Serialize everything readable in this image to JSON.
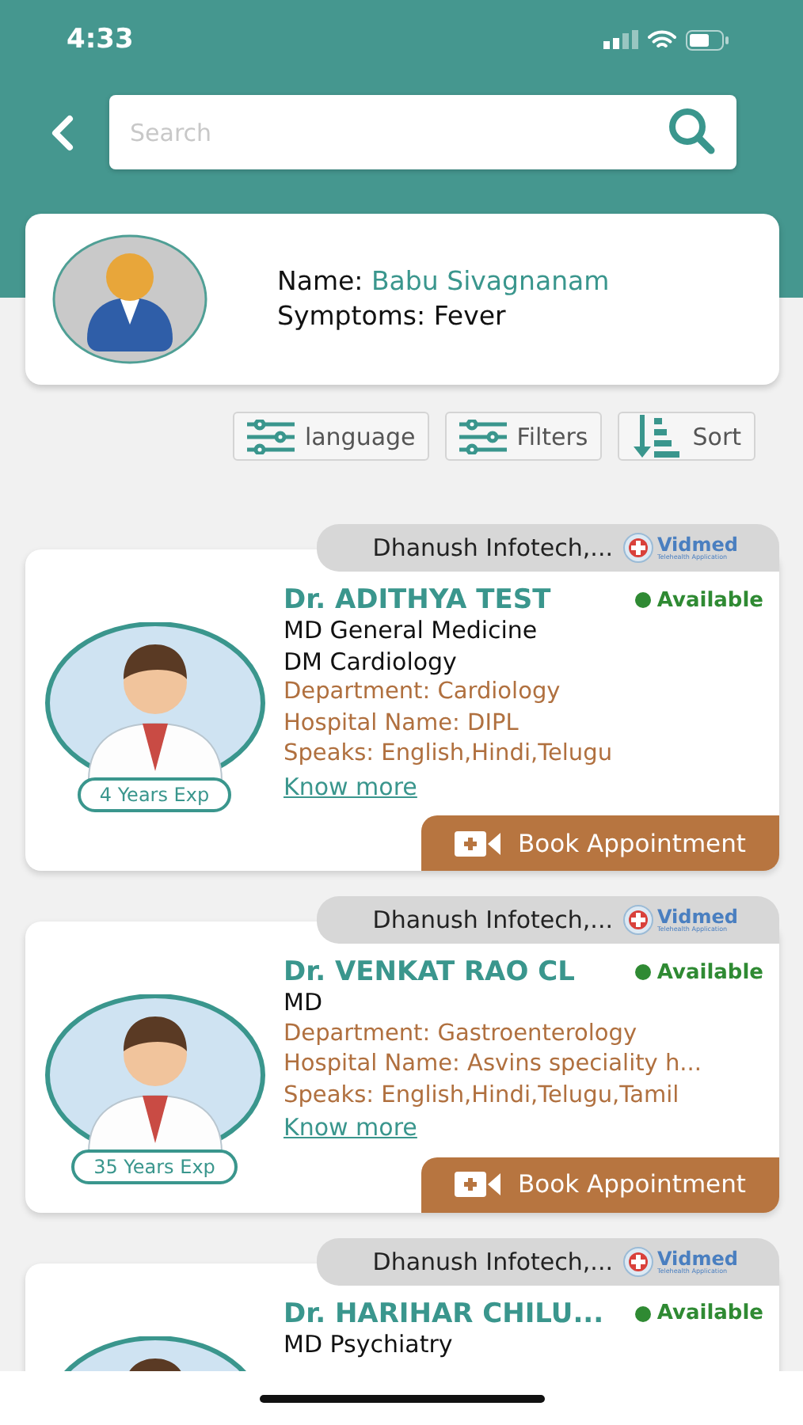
{
  "status_bar": {
    "time": "4:33"
  },
  "search": {
    "placeholder": "Search"
  },
  "patient": {
    "name_label": "Name:",
    "name": "Babu Sivagnanam",
    "symptoms": "Symptoms: Fever"
  },
  "filter_buttons": [
    {
      "kind": "filter",
      "label": "language"
    },
    {
      "kind": "filter",
      "label": "Filters"
    },
    {
      "kind": "sort",
      "label": "Sort"
    }
  ],
  "doctors": [
    {
      "tag": "Dhanush Infotech,...",
      "logo_name": "Vidmed",
      "logo_tagline": "Telehealth Application",
      "name": "Dr. ADITHYA TEST",
      "available": true,
      "availability": "Available",
      "degrees": [
        "MD General Medicine",
        "DM Cardiology"
      ],
      "department": "Department: Cardiology",
      "hospital": "Hospital Name: DIPL",
      "speaks": "Speaks: English,Hindi,Telugu",
      "know_more": "Know more",
      "experience": "4 Years Exp",
      "book": "Book Appointment"
    },
    {
      "tag": "Dhanush Infotech,...",
      "logo_name": "Vidmed",
      "logo_tagline": "Telehealth Application",
      "name": "Dr. VENKAT RAO CL",
      "available": true,
      "availability": "Available",
      "degrees": [
        "MD"
      ],
      "department": "Department: Gastroenterology",
      "hospital": "Hospital Name: Asvins speciality h...",
      "speaks": "Speaks: English,Hindi,Telugu,Tamil",
      "know_more": "Know more",
      "experience": "35 Years Exp",
      "book": "Book Appointment"
    },
    {
      "tag": "Dhanush Infotech,...",
      "logo_name": "Vidmed",
      "logo_tagline": "Telehealth Application",
      "name": "Dr. HARIHAR CHILU...",
      "available": true,
      "availability": "Available",
      "degrees": [
        "MD Psychiatry"
      ]
    }
  ]
}
